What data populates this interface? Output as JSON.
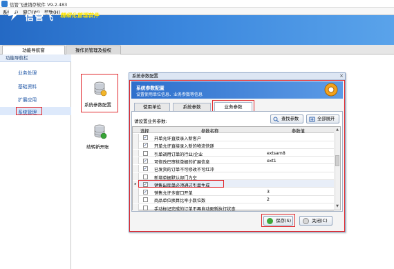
{
  "window": {
    "title": "信管飞进销存软件 V9.2.483"
  },
  "menu": [
    "系统(S)",
    "窗口(W)",
    "帮助(H)"
  ],
  "banner": {
    "logo_text": "信管飞",
    "slogan": "精细化管理软件"
  },
  "top_tabs": [
    "功能导航窗",
    "操作员管理及授权"
  ],
  "left_panel": {
    "header": "功能导航栏",
    "items": [
      "业务处理",
      "基础资料",
      "扩展应用",
      "系统管理"
    ],
    "active": "系统管理"
  },
  "main_icons": [
    {
      "label": "系统参数配置",
      "icon": "database-gear-icon"
    },
    {
      "label": "结转新开账",
      "icon": "database-refresh-icon"
    }
  ],
  "dialog": {
    "title": "系统参数配置",
    "close": "×",
    "banner_title": "系统参数配置",
    "banner_subtitle": "设置使用单位信息、业务参数等信息",
    "tabs": [
      "使用单位",
      "系统参数",
      "业务参数"
    ],
    "active_tab": "业务参数",
    "config_label": "请设置业务参数:",
    "find_button": "查找参数",
    "expand_button": "全部展开",
    "columns": [
      "选择",
      "参数名称",
      "参数值"
    ],
    "rows": [
      {
        "checked": true,
        "name": "开单允许直接录入新客户",
        "value": ""
      },
      {
        "checked": true,
        "name": "开单允许直接录入新的物流快递",
        "value": ""
      },
      {
        "checked": false,
        "name": "引单调用订单的行业/企业",
        "value": "extsam8"
      },
      {
        "checked": true,
        "name": "可修改已审核单据的扩展信息",
        "value": "ext1"
      },
      {
        "checked": true,
        "name": "已发货的订单不可修改不可红冲",
        "value": ""
      },
      {
        "checked": false,
        "name": "新增单据默认部门为空",
        "value": ""
      },
      {
        "checked": true,
        "name": "销售出库单必须通过引单生成",
        "value": ""
      },
      {
        "checked": true,
        "name": "销售允许多窗口开单",
        "value": "3"
      },
      {
        "checked": false,
        "name": "商品单位换算比率小数位数",
        "value": "2"
      },
      {
        "checked": false,
        "name": "手动标记完成的订单不再自动更新执行状态",
        "value": ""
      }
    ],
    "current_row_marker": "▸",
    "save_button": "保存(S)",
    "close_button": "关闭(C)"
  }
}
